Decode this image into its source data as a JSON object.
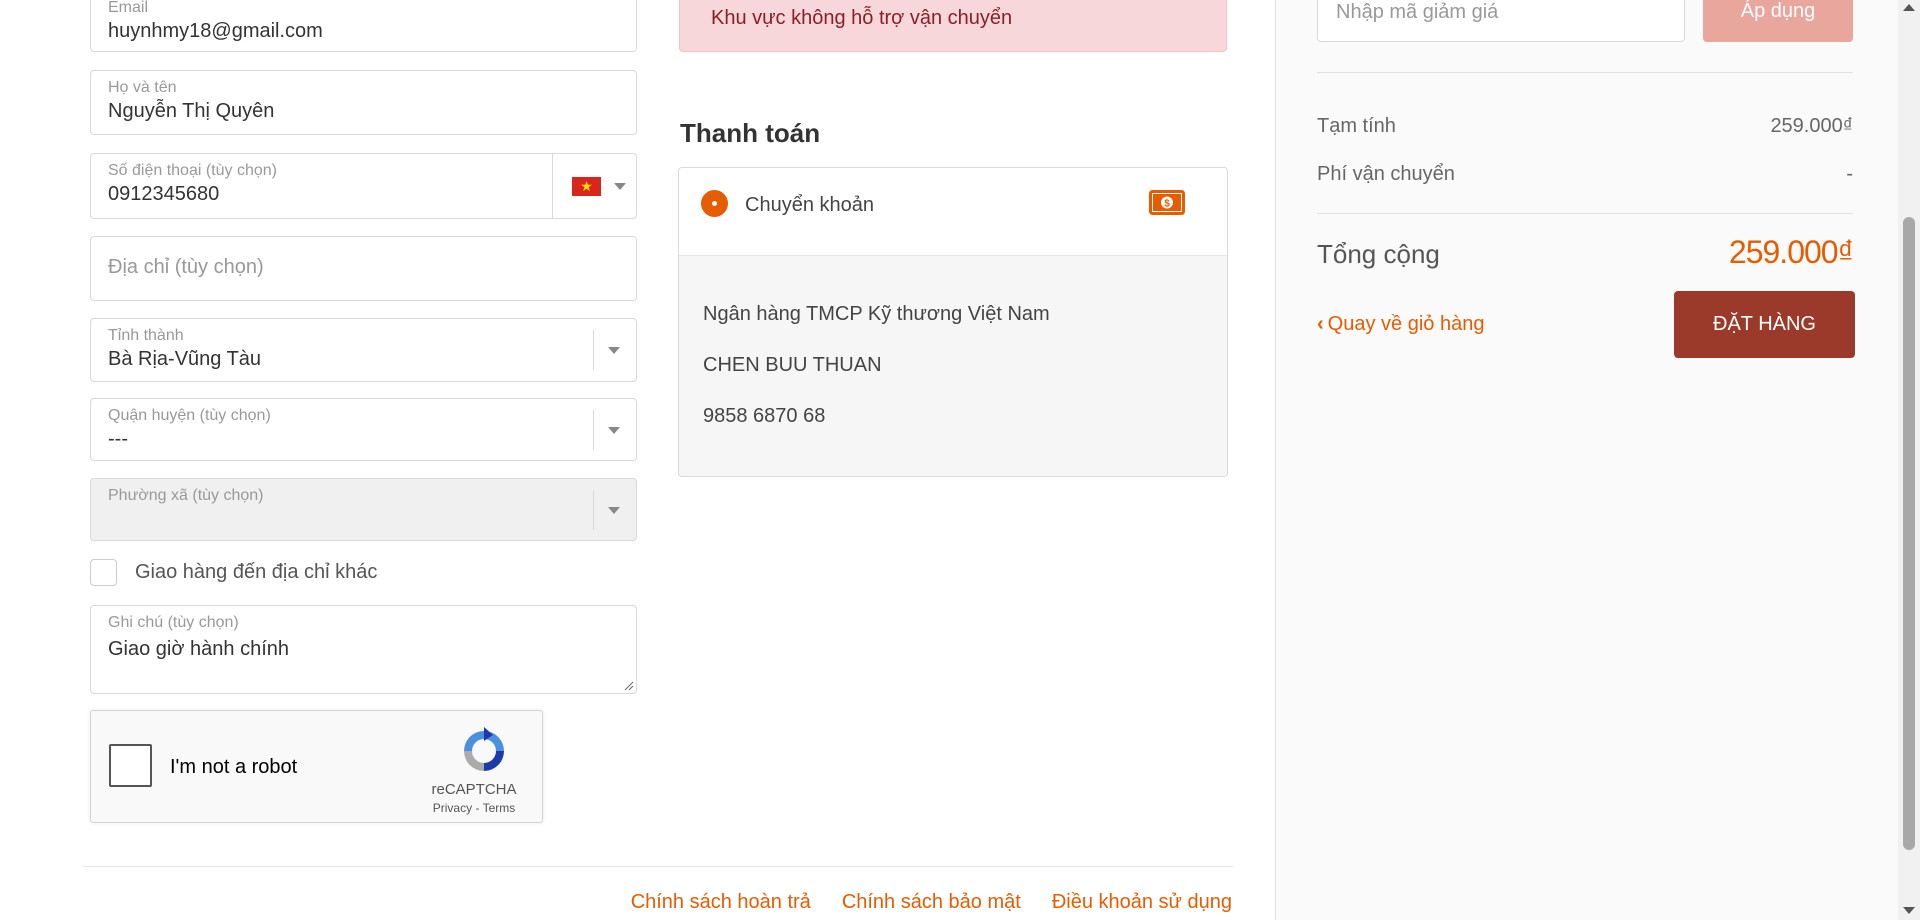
{
  "form": {
    "email": {
      "label": "Email",
      "value": "huynhmy18@gmail.com"
    },
    "fullname": {
      "label": "Họ và tên",
      "value": "Nguyễn Thị Quyên"
    },
    "phone": {
      "label": "Số điện thoại (tùy chọn)",
      "value": "0912345680",
      "flag_icon": "vietnam-flag-icon"
    },
    "address": {
      "placeholder": "Địa chỉ (tùy chọn)"
    },
    "province": {
      "label": "Tỉnh thành",
      "value": "Bà Rịa-Vũng Tàu"
    },
    "district": {
      "label": "Quận huyện (tùy chọn)",
      "value": "---"
    },
    "ward": {
      "label": "Phường xã (tùy chọn)"
    },
    "ship_other": {
      "label": "Giao hàng đến địa chỉ khác"
    },
    "note": {
      "label": "Ghi chú (tùy chọn)",
      "value": "Giao giờ hành chính"
    }
  },
  "recaptcha": {
    "label": "I'm not a robot",
    "brand": "reCAPTCHA",
    "privacy": "Privacy",
    "terms": "Terms"
  },
  "shipping": {
    "alert": "Khu vực không hỗ trợ vận chuyển"
  },
  "payment": {
    "title": "Thanh toán",
    "method": "Chuyển khoản",
    "bank": "Ngân hàng TMCP Kỹ thương Việt Nam",
    "account_name": "CHEN BUU THUAN",
    "account_number": "9858 6870 68"
  },
  "summary": {
    "coupon_placeholder": "Nhập mã giảm giá",
    "apply_label": "Áp dụng",
    "subtotal_label": "Tạm tính",
    "subtotal_value": "259.000₫",
    "shipping_label": "Phí vận chuyển",
    "shipping_value": "-",
    "total_label": "Tổng cộng",
    "total_value": "259.000₫",
    "back_label": "Quay về giỏ hàng",
    "order_label": "ĐẶT HÀNG"
  },
  "footer": {
    "links": [
      "Chính sách hoàn trả",
      "Chính sách bảo mật",
      "Điều khoản sử dụng"
    ]
  },
  "colors": {
    "accent": "#e65c00",
    "order_button": "#9b3a2a",
    "alert_bg": "#f8d7da",
    "apply_button": "#e9a69c"
  }
}
